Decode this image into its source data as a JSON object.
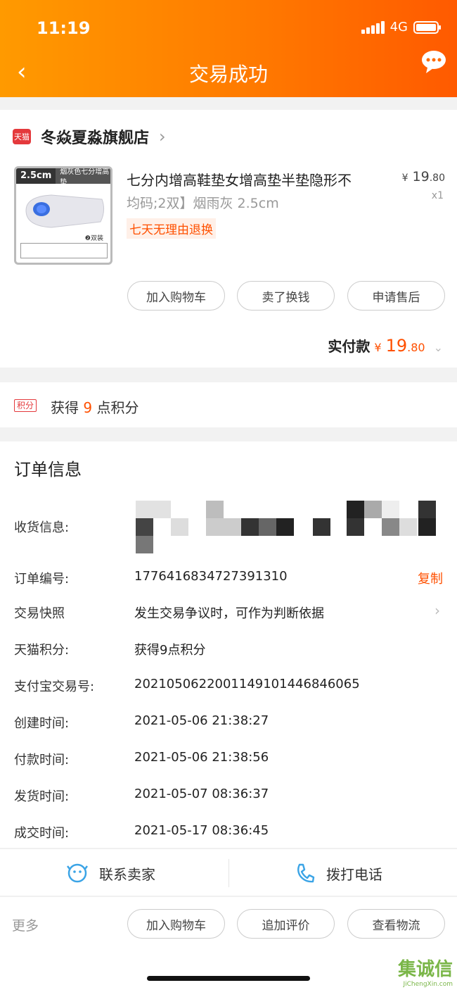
{
  "status": {
    "time": "11:19",
    "network": "4G"
  },
  "nav": {
    "back": "‹",
    "title": "交易成功"
  },
  "shop": {
    "badge": "天猫",
    "name": "冬焱夏淼旗舰店"
  },
  "product": {
    "thumb_tag_size": "2.5cm",
    "thumb_tag_text": "烟灰色七分增高垫",
    "thumb_pair": "❷双装",
    "title": "七分内增高鞋垫女增高垫半垫隐形不",
    "sku": "均码;2双】烟雨灰 2.5cm",
    "return_policy": "七天无理由退换",
    "price_yen": "¥",
    "price_int": "19",
    "price_dec": ".80",
    "qty": "x1"
  },
  "product_actions": [
    "加入购物车",
    "卖了换钱",
    "申请售后"
  ],
  "paid": {
    "label": "实付款",
    "yen": "¥",
    "int": "19",
    "dec": ".80"
  },
  "points": {
    "badge": "积分",
    "pre": "获得",
    "num": "9",
    "post": "点积分"
  },
  "order": {
    "title": "订单信息",
    "rows": [
      {
        "label": "收货信息:",
        "value": ""
      },
      {
        "label": "订单编号:",
        "value": "1776416834727391310",
        "action": "复制"
      },
      {
        "label": "交易快照",
        "value": "发生交易争议时，可作为判断依据"
      },
      {
        "label": "天猫积分:",
        "value": "获得9点积分"
      },
      {
        "label": "支付宝交易号:",
        "value": "2021050622001149101446846065"
      },
      {
        "label": "创建时间:",
        "value": "2021-05-06 21:38:27"
      },
      {
        "label": "付款时间:",
        "value": "2021-05-06 21:38:56"
      },
      {
        "label": "发货时间:",
        "value": "2021-05-07 08:36:37"
      },
      {
        "label": "成交时间:",
        "value": "2021-05-17 08:36:45"
      }
    ]
  },
  "contact": {
    "seller": "联系卖家",
    "phone": "拨打电话"
  },
  "footer": {
    "more": "更多",
    "buttons": [
      "加入购物车",
      "追加评价",
      "查看物流"
    ]
  },
  "watermark": {
    "text": "集诚信",
    "url": "JiChengXin.com"
  },
  "colors": {
    "accent": "#ff5000",
    "header_start": "#ff9a00",
    "header_end": "#ff5a00",
    "tmall_red": "#e4393c"
  }
}
